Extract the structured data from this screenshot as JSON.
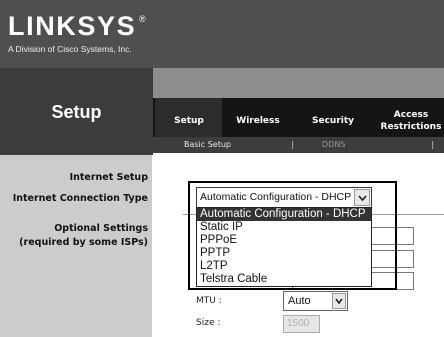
{
  "logo": {
    "brand": "LINKSYS",
    "registered": "®",
    "tagline": "A Division of Cisco Systems, Inc."
  },
  "page_title": "Setup",
  "tabs": [
    {
      "label": "Setup",
      "active": true
    },
    {
      "label": "Wireless",
      "active": false
    },
    {
      "label": "Security",
      "active": false
    },
    {
      "label": "Access Restrictions",
      "active": false
    }
  ],
  "subtabs": {
    "items": [
      {
        "label": "Basic Setup",
        "active": true
      },
      {
        "label": "DDNS",
        "active": false
      }
    ],
    "separator": "|"
  },
  "sidebar": {
    "section_title": "Internet Setup",
    "connection_type_label": "Internet Connection Type",
    "optional_settings_label": "Optional Settings",
    "optional_settings_note": "(required by some ISPs)"
  },
  "connection_type": {
    "selected": "Automatic Configuration - DHCP",
    "dropdown_open": true,
    "highlighted_index": 0,
    "options": [
      "Automatic Configuration - DHCP",
      "Static IP",
      "PPPoE",
      "PPTP",
      "L2TP",
      "Telstra Cable"
    ]
  },
  "optional_settings": {
    "mtu": {
      "label": "MTU :",
      "value": "Auto"
    },
    "size": {
      "label": "Size :",
      "value": "1500",
      "disabled": true
    }
  },
  "icons": {
    "select_arrow": "chevron-down-icon"
  },
  "colors": {
    "header": "#4f4f4f",
    "tab_bar": "#151515",
    "sidebar": "#cccccc",
    "option_highlight": "#333333"
  }
}
